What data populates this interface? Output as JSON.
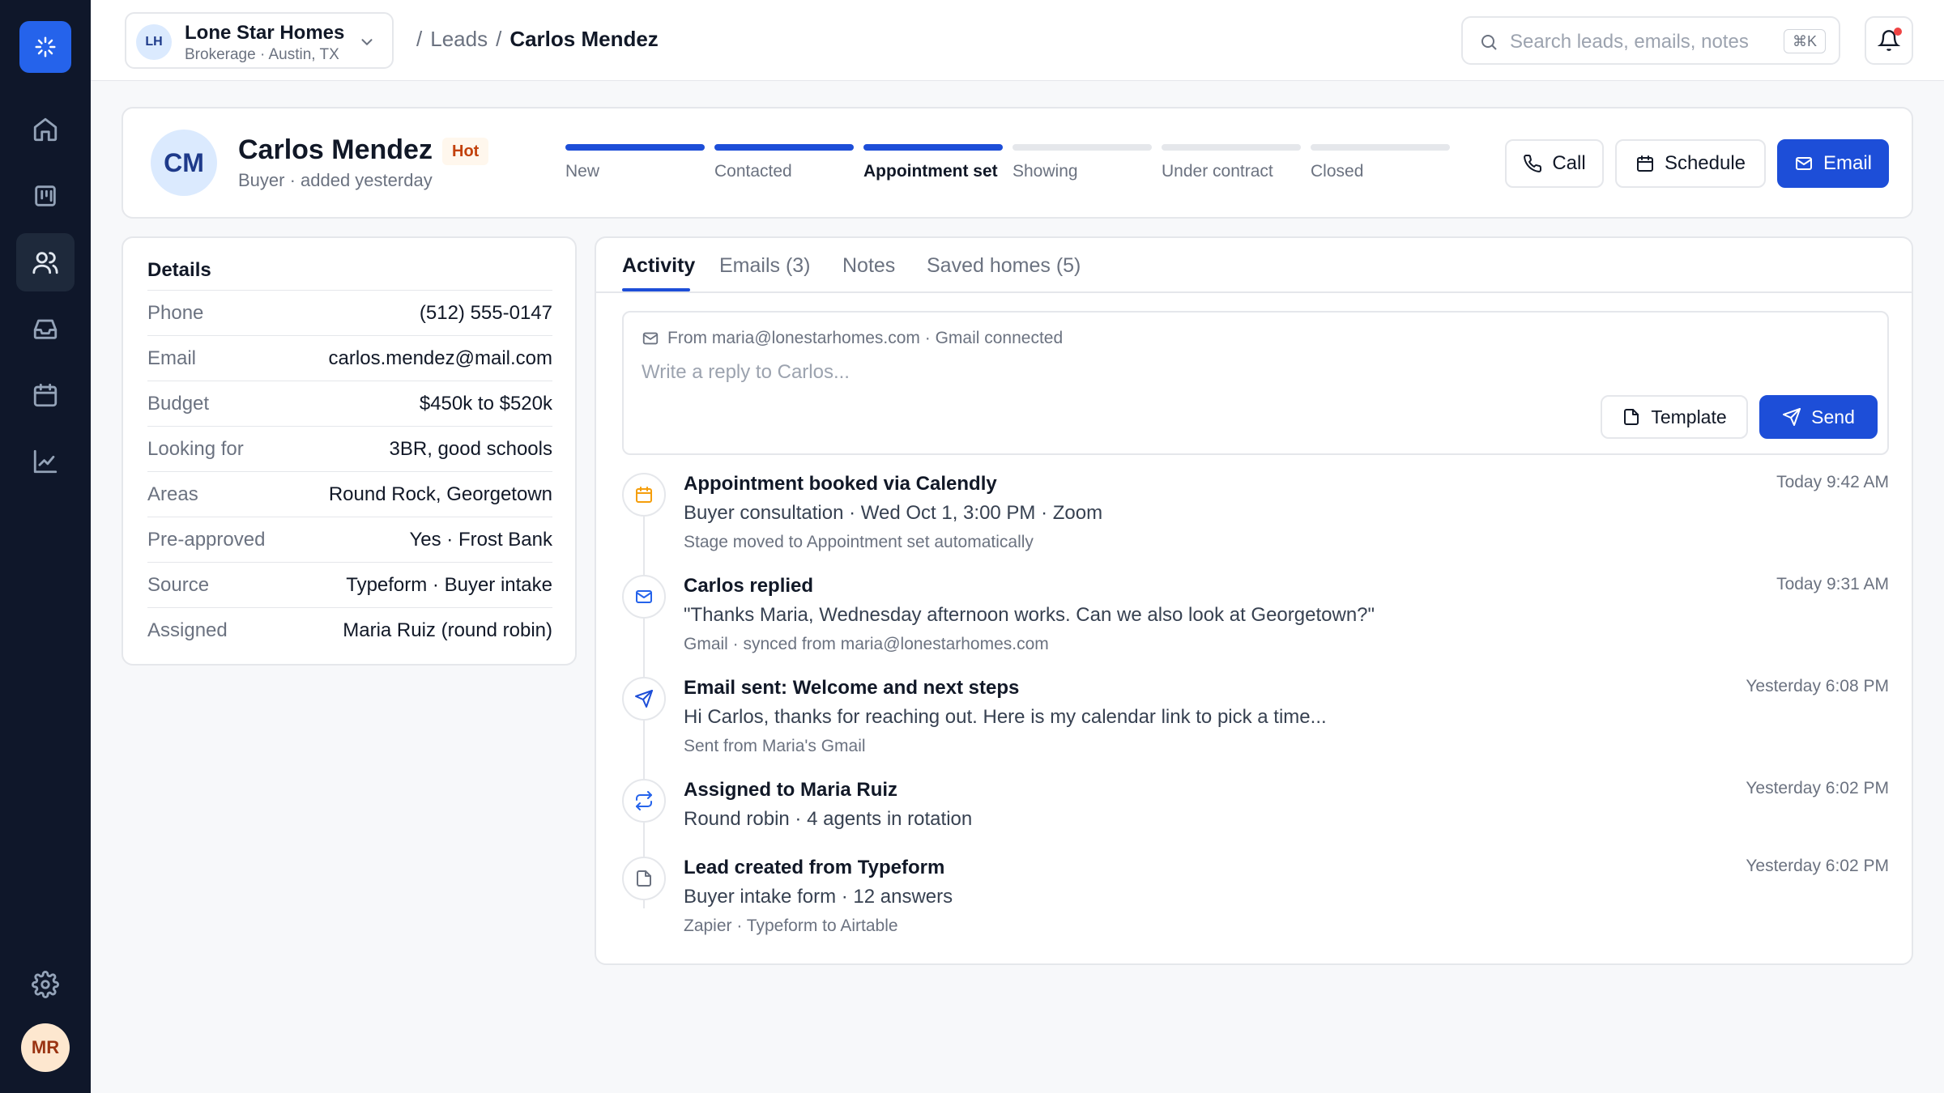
{
  "org": {
    "initials": "LH",
    "name": "Lone Star Homes",
    "sub": "Brokerage · Austin, TX"
  },
  "breadcrumb": {
    "sep": "/",
    "section": "Leads",
    "current": "Carlos Mendez"
  },
  "search": {
    "placeholder": "Search leads, emails, notes",
    "shortcut": "⌘K"
  },
  "user": {
    "initials": "MR"
  },
  "lead": {
    "initials": "CM",
    "name": "Carlos Mendez",
    "tag": "Hot",
    "sub": "Buyer · added yesterday",
    "stages": [
      {
        "label": "New",
        "done": true
      },
      {
        "label": "Contacted",
        "done": true
      },
      {
        "label": "Appointment set",
        "done": true
      },
      {
        "label": "Showing",
        "done": false
      },
      {
        "label": "Under contract",
        "done": false
      },
      {
        "label": "Closed",
        "done": false
      }
    ],
    "current_stage": "Appointment set",
    "actions": {
      "call": "Call",
      "schedule": "Schedule",
      "email": "Email"
    }
  },
  "details": {
    "title": "Details",
    "rows": [
      {
        "k": "Phone",
        "v": "(512) 555-0147"
      },
      {
        "k": "Email",
        "v": "carlos.mendez@mail.com"
      },
      {
        "k": "Budget",
        "v": "$450k to $520k"
      },
      {
        "k": "Looking for",
        "v": "3BR, good schools"
      },
      {
        "k": "Areas",
        "v": "Round Rock, Georgetown"
      },
      {
        "k": "Pre-approved",
        "v": "Yes · Frost Bank"
      },
      {
        "k": "Source",
        "v": "Typeform · Buyer intake"
      },
      {
        "k": "Assigned",
        "v": "Maria Ruiz (round robin)"
      }
    ]
  },
  "tabs": [
    {
      "label": "Activity",
      "active": true
    },
    {
      "label": "Emails (3)",
      "active": false
    },
    {
      "label": "Notes",
      "active": false
    },
    {
      "label": "Saved homes (5)",
      "active": false
    }
  ],
  "composer": {
    "from": "From maria@lonestarhomes.com · Gmail connected",
    "placeholder": "Write a reply to Carlos...",
    "template_label": "Template",
    "send_label": "Send"
  },
  "events": [
    {
      "icon": "calendar-icon",
      "color": "#f59e0b",
      "title": "Appointment booked via Calendly",
      "body": "Buyer consultation · Wed Oct 1, 3:00 PM · Zoom",
      "meta": "Stage moved to Appointment set automatically",
      "time": "Today 9:42 AM"
    },
    {
      "icon": "mail-icon",
      "color": "#2563eb",
      "title": "Carlos replied",
      "body": "\"Thanks Maria, Wednesday afternoon works. Can we also look at Georgetown?\"",
      "meta": "Gmail · synced from maria@lonestarhomes.com",
      "time": "Today 9:31 AM"
    },
    {
      "icon": "send-icon",
      "color": "#1d4ed8",
      "title": "Email sent: Welcome and next steps",
      "body": "Hi Carlos, thanks for reaching out. Here is my calendar link to pick a time...",
      "meta": "Sent from Maria's Gmail",
      "time": "Yesterday 6:08 PM"
    },
    {
      "icon": "repeat-icon",
      "color": "#2563eb",
      "title": "Assigned to Maria Ruiz",
      "body": "Round robin · 4 agents in rotation",
      "meta": "",
      "time": "Yesterday 6:02 PM"
    },
    {
      "icon": "file-icon",
      "color": "#6b7280",
      "title": "Lead created from Typeform",
      "body": "Buyer intake form · 12 answers",
      "meta": "Zapier · Typeform to Airtable",
      "time": "Yesterday 6:02 PM"
    }
  ],
  "colors": {
    "accent": "#1d4ed8",
    "sidebar": "#0f172a",
    "hot": "#c2410c"
  }
}
